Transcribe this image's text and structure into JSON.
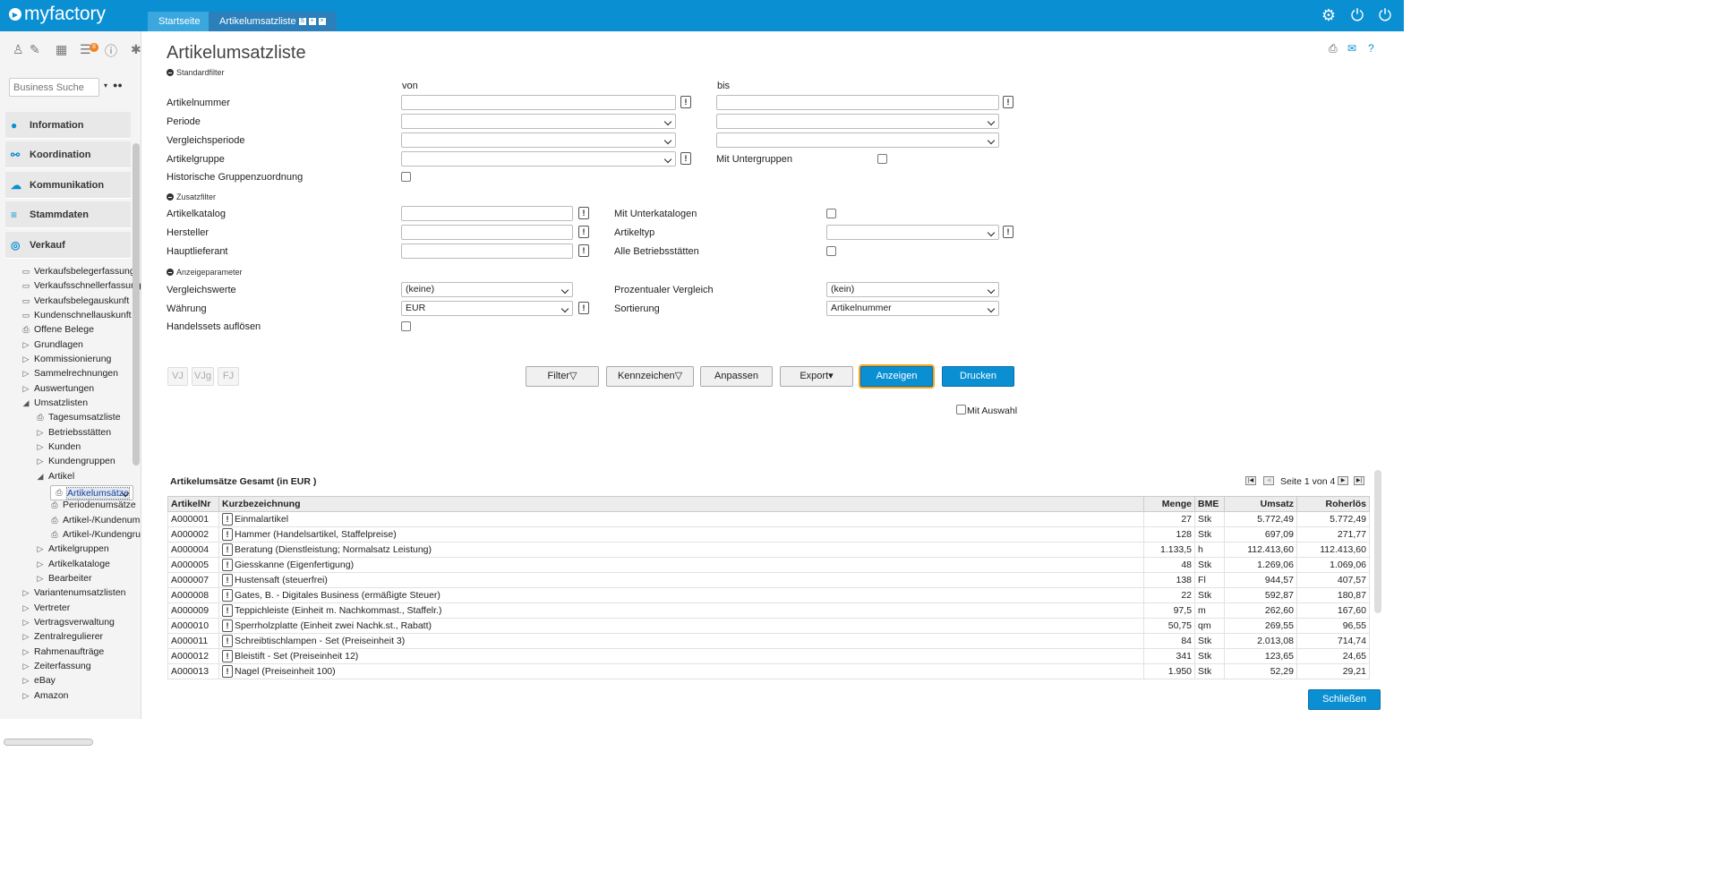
{
  "app": {
    "logo": "myfactory"
  },
  "tabs": [
    {
      "label": "Startseite"
    },
    {
      "label": "Artikelumsatzliste"
    }
  ],
  "sidebar": {
    "badge": "8",
    "search_placeholder": "Business Suche",
    "sections": [
      {
        "label": "Information"
      },
      {
        "label": "Koordination"
      },
      {
        "label": "Kommunikation"
      },
      {
        "label": "Stammdaten"
      },
      {
        "label": "Verkauf"
      }
    ],
    "items": [
      "Verkaufsbelegerfassung",
      "Verkaufsschnellerfassung",
      "Verkaufsbelegauskunft",
      "Kundenschnellauskunft",
      "Offene Belege",
      "Grundlagen",
      "Kommissionierung",
      "Sammelrechnungen",
      "Auswertungen",
      "Umsatzlisten",
      "Tagesumsatzliste",
      "Betriebsstätten",
      "Kunden",
      "Kundengruppen",
      "Artikel",
      "Artikelumsätze",
      "Periodenumsätze",
      "Artikel-/Kundenum",
      "Artikel-/Kundengru",
      "Artikelgruppen",
      "Artikelkataloge",
      "Bearbeiter",
      "Variantenumsatzlisten",
      "Vertreter",
      "Vertragsverwaltung",
      "Zentralregulierer",
      "Rahmenaufträge",
      "Zeiterfassung",
      "eBay",
      "Amazon"
    ]
  },
  "page": {
    "title": "Artikelumsatzliste",
    "groups": {
      "standard": "Standardfilter",
      "zusatz": "Zusatzfilter",
      "anzeige": "Anzeigeparameter"
    },
    "von": "von",
    "bis": "bis",
    "labels": {
      "artikelnummer": "Artikelnummer",
      "periode": "Periode",
      "vergleichsperiode": "Vergleichsperiode",
      "artikelgruppe": "Artikelgruppe",
      "historische": "Historische Gruppenzuordnung",
      "mit_untergruppen": "Mit Untergruppen",
      "artikelkatalog": "Artikelkatalog",
      "hersteller": "Hersteller",
      "hauptlieferant": "Hauptlieferant",
      "mit_unterkatalogen": "Mit Unterkatalogen",
      "artikeltyp": "Artikeltyp",
      "alle_betriebsstaetten": "Alle Betriebsstätten",
      "vergleichswerte": "Vergleichswerte",
      "waehrung": "Währung",
      "handelssets": "Handelssets auflösen",
      "prozentualer": "Prozentualer Vergleich",
      "sortierung": "Sortierung"
    },
    "values": {
      "vergleichswerte": "(keine)",
      "waehrung": "EUR",
      "prozentualer": "(kein)",
      "sortierung": "Artikelnummer"
    },
    "buttons": {
      "vj": "VJ",
      "vjg": "VJg",
      "fj": "FJ",
      "filter": "Filter",
      "kennzeichen": "Kennzeichen",
      "anpassen": "Anpassen",
      "export": "Export",
      "anzeigen": "Anzeigen",
      "drucken": "Drucken",
      "schliessen": "Schließen"
    },
    "mit_auswahl": "Mit Auswahl"
  },
  "result": {
    "title": "Artikelumsätze Gesamt (in EUR )",
    "pager": "Seite 1 von 4",
    "columns": [
      "ArtikelNr",
      "Kurzbezeichnung",
      "Menge",
      "BME",
      "Umsatz",
      "Roherlös"
    ],
    "rows": [
      [
        "A000001",
        "Einmalartikel",
        "27",
        "Stk",
        "5.772,49",
        "5.772,49"
      ],
      [
        "A000002",
        "Hammer (Handelsartikel, Staffelpreise)",
        "128",
        "Stk",
        "697,09",
        "271,77"
      ],
      [
        "A000004",
        "Beratung (Dienstleistung; Normalsatz Leistung)",
        "1.133,5",
        "h",
        "112.413,60",
        "112.413,60"
      ],
      [
        "A000005",
        "Giesskanne (Eigenfertigung)",
        "48",
        "Stk",
        "1.269,06",
        "1.069,06"
      ],
      [
        "A000007",
        "Hustensaft (steuerfrei)",
        "138",
        "Fl",
        "944,57",
        "407,57"
      ],
      [
        "A000008",
        "Gates, B. - Digitales Business (ermäßigte Steuer)",
        "22",
        "Stk",
        "592,87",
        "180,87"
      ],
      [
        "A000009",
        "Teppichleiste (Einheit m. Nachkommast., Staffelr.)",
        "97,5",
        "m",
        "262,60",
        "167,60"
      ],
      [
        "A000010",
        "Sperrholzplatte (Einheit zwei Nachk.st., Rabatt)",
        "50,75",
        "qm",
        "269,55",
        "96,55"
      ],
      [
        "A000011",
        "Schreibtischlampen - Set (Preiseinheit 3)",
        "84",
        "Stk",
        "2.013,08",
        "714,74"
      ],
      [
        "A000012",
        "Bleistift - Set (Preiseinheit 12)",
        "341",
        "Stk",
        "123,65",
        "24,65"
      ],
      [
        "A000013",
        "Nagel (Preiseinheit 100)",
        "1.950",
        "Stk",
        "52,29",
        "29,21"
      ]
    ]
  }
}
